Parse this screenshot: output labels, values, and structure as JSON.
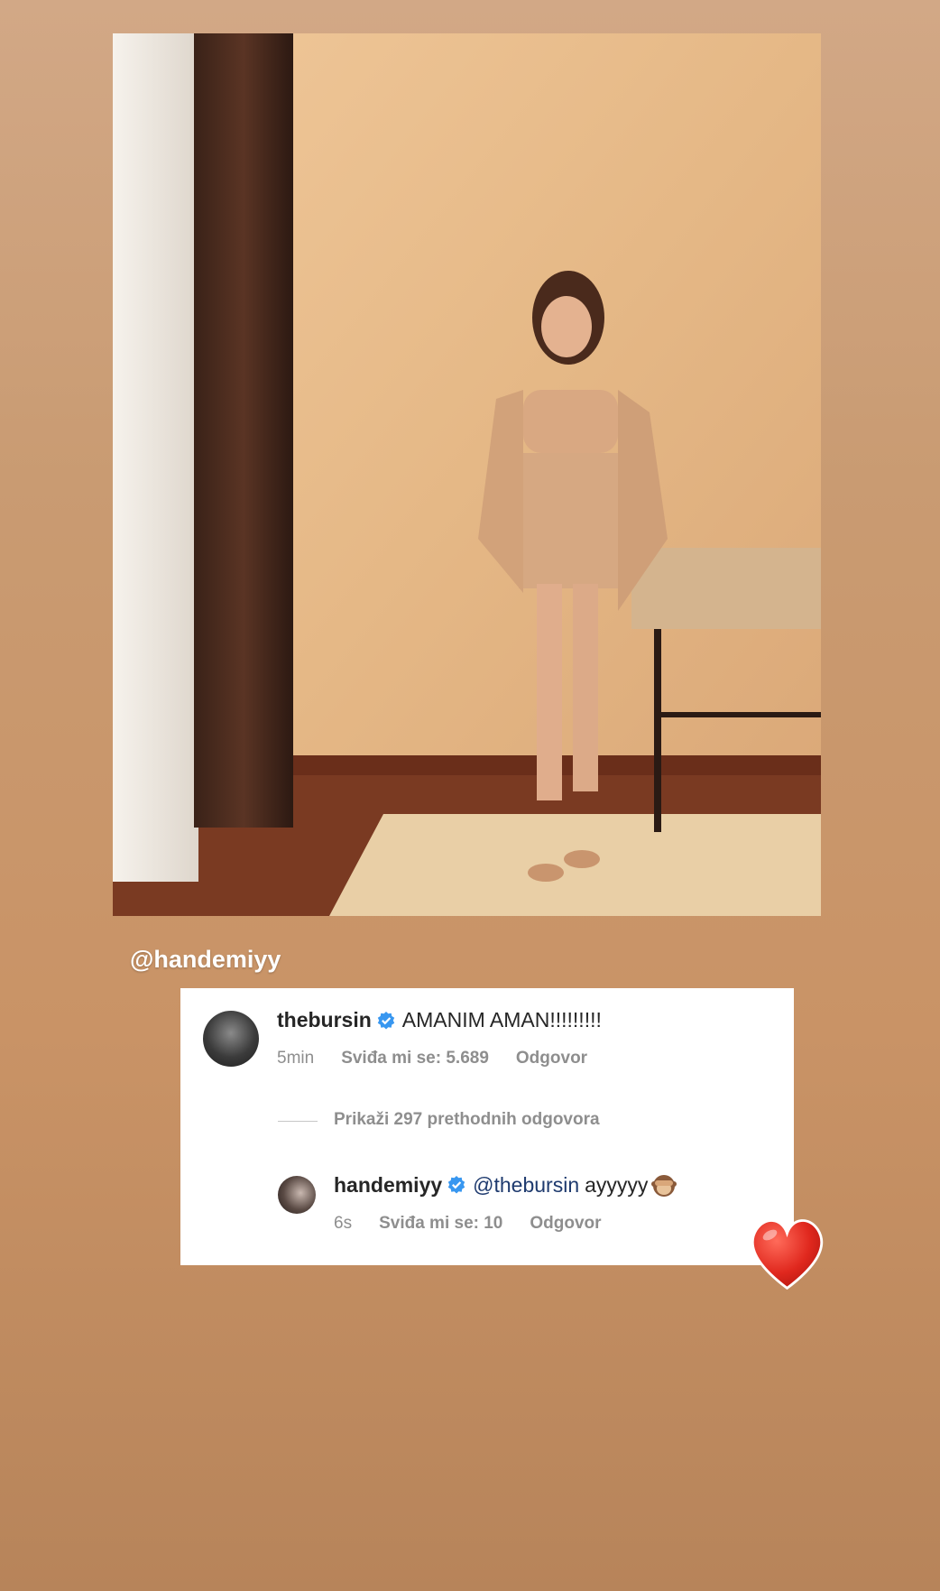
{
  "story": {
    "mention_tag": "@handemiyy"
  },
  "comments": {
    "parent": {
      "username": "thebursin",
      "text": "AMANIM AMAN!!!!!!!!!",
      "time": "5min",
      "likes": "Sviđa mi se: 5.689",
      "reply_label": "Odgovor"
    },
    "show_previous": "Prikaži 297 prethodnih odgovora",
    "reply": {
      "username": "handemiyy",
      "mention": "@thebursin",
      "text": "ayyyyy",
      "time": "6s",
      "likes": "Sviđa mi se: 10",
      "reply_label": "Odgovor"
    }
  },
  "colors": {
    "verified_badge": "#3897f0",
    "heart": "#e0281e"
  },
  "icons": {
    "verified": "verified-badge-icon",
    "monkey": "see-no-evil-monkey-icon",
    "heart": "heart-sticker-icon"
  }
}
